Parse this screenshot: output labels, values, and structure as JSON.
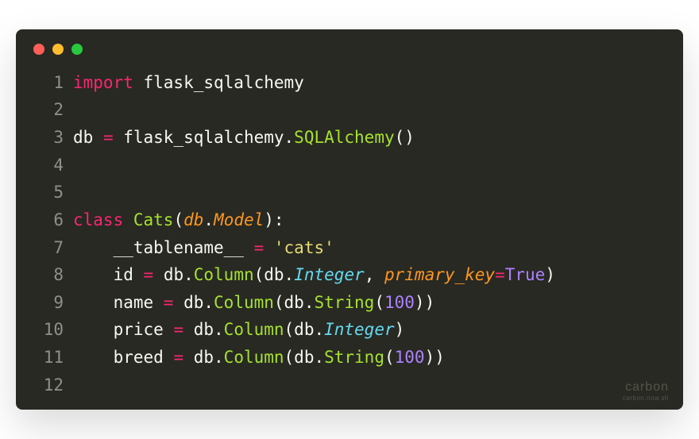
{
  "watermark": {
    "name": "carbon",
    "url": "carbon.now.sh"
  },
  "lines": [
    {
      "n": "1",
      "tokens": [
        {
          "c": "kw",
          "t": "import"
        },
        {
          "c": "txt",
          "t": " flask_sqlalchemy"
        }
      ]
    },
    {
      "n": "2",
      "tokens": []
    },
    {
      "n": "3",
      "tokens": [
        {
          "c": "txt",
          "t": "db "
        },
        {
          "c": "op",
          "t": "="
        },
        {
          "c": "txt",
          "t": " flask_sqlalchemy."
        },
        {
          "c": "cls",
          "t": "SQLAlchemy"
        },
        {
          "c": "txt",
          "t": "()"
        }
      ]
    },
    {
      "n": "4",
      "tokens": []
    },
    {
      "n": "5",
      "tokens": []
    },
    {
      "n": "6",
      "tokens": [
        {
          "c": "kw",
          "t": "class"
        },
        {
          "c": "txt",
          "t": " "
        },
        {
          "c": "cls",
          "t": "Cats"
        },
        {
          "c": "txt",
          "t": "("
        },
        {
          "c": "param",
          "t": "db"
        },
        {
          "c": "txt",
          "t": "."
        },
        {
          "c": "param",
          "t": "Model"
        },
        {
          "c": "txt",
          "t": "):"
        }
      ]
    },
    {
      "n": "7",
      "tokens": [
        {
          "c": "txt",
          "t": "    __tablename__ "
        },
        {
          "c": "op",
          "t": "="
        },
        {
          "c": "txt",
          "t": " "
        },
        {
          "c": "str",
          "t": "'cats'"
        }
      ]
    },
    {
      "n": "8",
      "tokens": [
        {
          "c": "txt",
          "t": "    id "
        },
        {
          "c": "op",
          "t": "="
        },
        {
          "c": "txt",
          "t": " db."
        },
        {
          "c": "fn",
          "t": "Column"
        },
        {
          "c": "txt",
          "t": "(db."
        },
        {
          "c": "attr",
          "t": "Integer"
        },
        {
          "c": "txt",
          "t": ", "
        },
        {
          "c": "param",
          "t": "primary_key"
        },
        {
          "c": "op",
          "t": "="
        },
        {
          "c": "const",
          "t": "True"
        },
        {
          "c": "txt",
          "t": ")"
        }
      ]
    },
    {
      "n": "9",
      "tokens": [
        {
          "c": "txt",
          "t": "    name "
        },
        {
          "c": "op",
          "t": "="
        },
        {
          "c": "txt",
          "t": " db."
        },
        {
          "c": "fn",
          "t": "Column"
        },
        {
          "c": "txt",
          "t": "(db."
        },
        {
          "c": "fn",
          "t": "String"
        },
        {
          "c": "txt",
          "t": "("
        },
        {
          "c": "num",
          "t": "100"
        },
        {
          "c": "txt",
          "t": "))"
        }
      ]
    },
    {
      "n": "10",
      "tokens": [
        {
          "c": "txt",
          "t": "    price "
        },
        {
          "c": "op",
          "t": "="
        },
        {
          "c": "txt",
          "t": " db."
        },
        {
          "c": "fn",
          "t": "Column"
        },
        {
          "c": "txt",
          "t": "(db."
        },
        {
          "c": "attr",
          "t": "Integer"
        },
        {
          "c": "txt",
          "t": ")"
        }
      ]
    },
    {
      "n": "11",
      "tokens": [
        {
          "c": "txt",
          "t": "    breed "
        },
        {
          "c": "op",
          "t": "="
        },
        {
          "c": "txt",
          "t": " db."
        },
        {
          "c": "fn",
          "t": "Column"
        },
        {
          "c": "txt",
          "t": "(db."
        },
        {
          "c": "fn",
          "t": "String"
        },
        {
          "c": "txt",
          "t": "("
        },
        {
          "c": "num",
          "t": "100"
        },
        {
          "c": "txt",
          "t": "))"
        }
      ]
    },
    {
      "n": "12",
      "tokens": []
    }
  ]
}
